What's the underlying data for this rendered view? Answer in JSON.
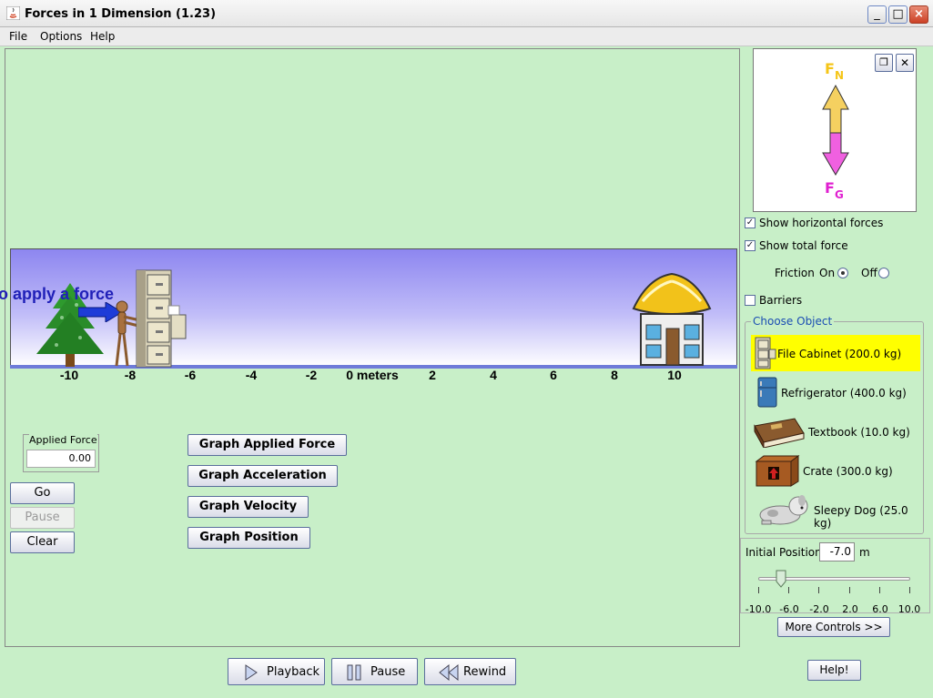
{
  "window": {
    "title": "Forces in 1 Dimension (1.23)",
    "min": "_",
    "max": "□",
    "close": "×"
  },
  "menu": {
    "file": "File",
    "options": "Options",
    "help": "Help"
  },
  "scene": {
    "hint": "o apply a force",
    "ticks": [
      "-10",
      "-8",
      "-6",
      "-4",
      "-2",
      "0 meters",
      "2",
      "4",
      "6",
      "8",
      "10"
    ]
  },
  "applied_force": {
    "label": "Applied Force",
    "value": "0.00"
  },
  "controls": {
    "go": "Go",
    "pause": "Pause",
    "clear": "Clear"
  },
  "graphs": {
    "applied": "Graph Applied Force",
    "acceleration": "Graph Acceleration",
    "velocity": "Graph Velocity",
    "position": "Graph Position"
  },
  "fbd": {
    "fn_main": "F",
    "fn_sub": "N",
    "fg_main": "F",
    "fg_sub": "G",
    "fn_color": "#f5c518",
    "fg_color": "#e020d0"
  },
  "options": {
    "show_horizontal": "Show horizontal forces",
    "show_total": "Show total force",
    "friction_label": "Friction",
    "friction_on": "On",
    "friction_off": "Off",
    "barriers": "Barriers"
  },
  "objects": {
    "legend": "Choose Object",
    "items": [
      {
        "label": "File Cabinet (200.0 kg)",
        "icon": "file-cabinet-icon"
      },
      {
        "label": "Refrigerator (400.0 kg)",
        "icon": "refrigerator-icon"
      },
      {
        "label": "Textbook (10.0 kg)",
        "icon": "textbook-icon"
      },
      {
        "label": "Crate (300.0 kg)",
        "icon": "crate-icon"
      },
      {
        "label": "Sleepy Dog (25.0 kg)",
        "icon": "dog-icon"
      }
    ],
    "selected": 0
  },
  "initial_position": {
    "label": "Initial Position",
    "value": "-7.0",
    "unit": "m",
    "slider_value": -7.0,
    "slider_min": -10.0,
    "slider_max": 10.0,
    "ticks": [
      "-10.0",
      "-6.0",
      "-2.0",
      "2.0",
      "6.0",
      "10.0"
    ]
  },
  "more_controls": "More Controls >>",
  "playback": {
    "playback": "Playback",
    "pause": "Pause",
    "rewind": "Rewind"
  },
  "help_button": "Help!"
}
